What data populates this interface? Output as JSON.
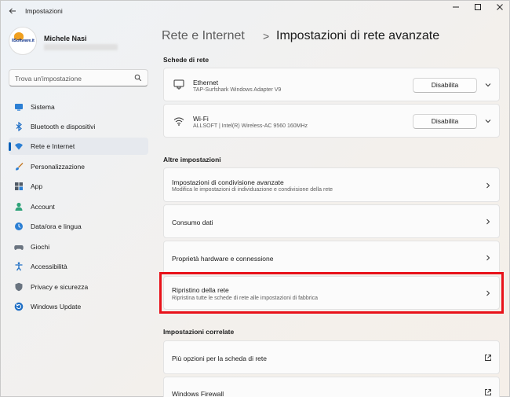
{
  "window": {
    "title": "Impostazioni",
    "back_icon": "arrow-left-icon",
    "controls": [
      "minimize-icon",
      "maximize-icon",
      "close-icon"
    ]
  },
  "profile": {
    "name": "Michele Nasi",
    "avatar_text": "IlSoftware.it"
  },
  "search": {
    "placeholder": "Trova un'impostazione"
  },
  "sidebar": {
    "items": [
      {
        "label": "Sistema",
        "icon": "system-icon",
        "active": false
      },
      {
        "label": "Bluetooth e dispositivi",
        "icon": "bluetooth-icon",
        "active": false
      },
      {
        "label": "Rete e Internet",
        "icon": "wifi-icon",
        "active": true
      },
      {
        "label": "Personalizzazione",
        "icon": "brush-icon",
        "active": false
      },
      {
        "label": "App",
        "icon": "apps-icon",
        "active": false
      },
      {
        "label": "Account",
        "icon": "account-icon",
        "active": false
      },
      {
        "label": "Data/ora e lingua",
        "icon": "globe-clock-icon",
        "active": false
      },
      {
        "label": "Giochi",
        "icon": "gamepad-icon",
        "active": false
      },
      {
        "label": "Accessibilità",
        "icon": "accessibility-icon",
        "active": false
      },
      {
        "label": "Privacy e sicurezza",
        "icon": "shield-icon",
        "active": false
      },
      {
        "label": "Windows Update",
        "icon": "update-icon",
        "active": false
      }
    ]
  },
  "breadcrumb": {
    "parent": "Rete e Internet",
    "separator": ">",
    "current": "Impostazioni di rete avanzate"
  },
  "network_adapters": {
    "title": "Schede di rete",
    "items": [
      {
        "name": "Ethernet",
        "description": "TAP-Surfshark Windows Adapter V9",
        "button": "Disabilita",
        "icon": "ethernet-icon"
      },
      {
        "name": "Wi-Fi",
        "description": "ALLSOFT | Intel(R) Wireless-AC 9560 160MHz",
        "button": "Disabilita",
        "icon": "wifi-icon"
      }
    ]
  },
  "other_settings": {
    "title": "Altre impostazioni",
    "items": [
      {
        "title": "Impostazioni di condivisione avanzate",
        "subtitle": "Modifica le impostazioni di individuazione e condivisione della rete"
      },
      {
        "title": "Consumo dati",
        "subtitle": ""
      },
      {
        "title": "Proprietà hardware e connessione",
        "subtitle": ""
      },
      {
        "title": "Ripristino della rete",
        "subtitle": "Ripristina tutte le schede di rete alle impostazioni di fabbrica"
      }
    ]
  },
  "related_settings": {
    "title": "Impostazioni correlate",
    "items": [
      {
        "title": "Più opzioni per la scheda di rete",
        "icon": "external-link-icon"
      },
      {
        "title": "Windows Firewall",
        "icon": "external-link-icon"
      }
    ]
  },
  "colors": {
    "accent": "#005fb8",
    "highlight": "#e8121a"
  }
}
